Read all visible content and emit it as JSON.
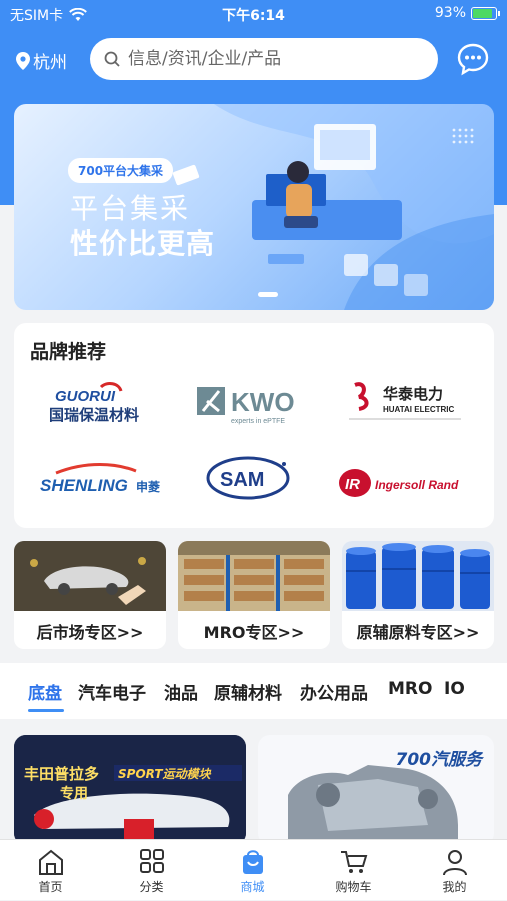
{
  "status_bar": {
    "carrier": "无SIM卡",
    "time": "下午6:14",
    "battery": "93%"
  },
  "header": {
    "location": "杭州",
    "search_placeholder": "信息/资讯/企业/产品"
  },
  "banner": {
    "tag": "700平台大集采",
    "title": "平台集采",
    "subtitle": "性价比更高"
  },
  "brands": {
    "title": "品牌推荐",
    "items": [
      {
        "name": "国瑞保温材料",
        "logo_text": "GUORUI"
      },
      {
        "name": "KWO",
        "logo_text": "KWO",
        "tagline": "experts in ePTFE"
      },
      {
        "name": "华泰电力",
        "logo_text": "HUATAI ELECTRIC"
      },
      {
        "name": "申菱",
        "logo_text": "SHENLING"
      },
      {
        "name": "SAM",
        "logo_text": "SAM"
      },
      {
        "name": "Ingersoll Rand",
        "logo_text": "IR"
      }
    ]
  },
  "zones": [
    {
      "label": "后市场专区>>"
    },
    {
      "label": "MRO专区>>"
    },
    {
      "label": "原辅原料专区>>"
    }
  ],
  "categories": {
    "items": [
      "底盘",
      "汽车电子",
      "油品",
      "原辅材料",
      "办公用品",
      "MRO",
      "IO"
    ],
    "active_index": 0
  },
  "products": {
    "card1": {
      "line1": "丰田普拉多",
      "line2": "专用",
      "badge": "SPORT运动模块"
    },
    "card2": {
      "brand": "700汽服务"
    }
  },
  "tabbar": {
    "items": [
      {
        "label": "首页",
        "icon": "home-icon"
      },
      {
        "label": "分类",
        "icon": "grid-icon"
      },
      {
        "label": "商城",
        "icon": "shop-bag-icon"
      },
      {
        "label": "购物车",
        "icon": "cart-icon"
      },
      {
        "label": "我的",
        "icon": "user-icon"
      }
    ],
    "active_index": 2
  },
  "colors": {
    "accent": "#3f8ef5",
    "active_tab": "#3f8ef5"
  }
}
